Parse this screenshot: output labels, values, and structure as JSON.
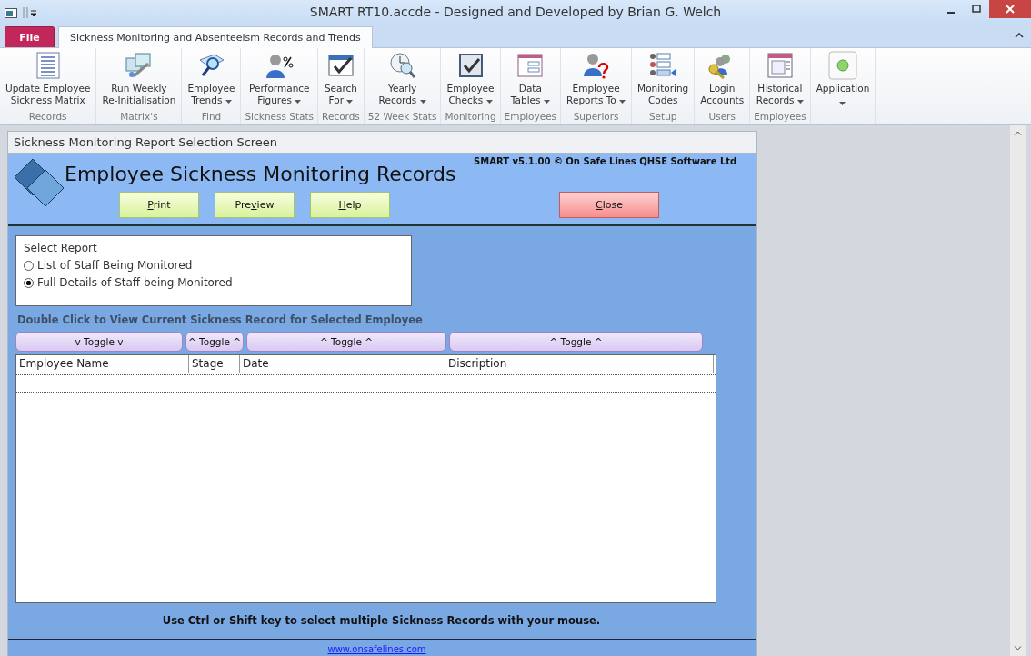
{
  "window": {
    "title": "SMART RT10.accde - Designed and Developed by Brian G. Welch"
  },
  "ribbon_tabs": [
    {
      "label": "File",
      "kind": "file",
      "selected": false
    },
    {
      "label": "Sickness Monitoring and Absenteeism Records and Trends",
      "kind": "tab",
      "selected": true
    }
  ],
  "ribbon_groups": [
    {
      "label": "Records",
      "button": {
        "lines": [
          "Update Employee",
          "Sickness Matrix"
        ],
        "dropdown": false
      }
    },
    {
      "label": "Matrix's",
      "button": {
        "lines": [
          "Run Weekly",
          "Re-Initialisation"
        ],
        "dropdown": false
      }
    },
    {
      "label": "Find",
      "button": {
        "lines": [
          "Employee",
          "Trends"
        ],
        "dropdown": true
      }
    },
    {
      "label": "Sickness Stats",
      "button": {
        "lines": [
          "Performance",
          "Figures"
        ],
        "dropdown": true
      }
    },
    {
      "label": "Records",
      "button": {
        "lines": [
          "Search",
          "For"
        ],
        "dropdown": true
      }
    },
    {
      "label": "52 Week Stats",
      "button": {
        "lines": [
          "Yearly",
          "Records"
        ],
        "dropdown": true
      }
    },
    {
      "label": "Monitoring",
      "button": {
        "lines": [
          "Employee",
          "Checks"
        ],
        "dropdown": true
      }
    },
    {
      "label": "Employees",
      "button": {
        "lines": [
          "Data",
          "Tables"
        ],
        "dropdown": true
      }
    },
    {
      "label": "Superiors",
      "button": {
        "lines": [
          "Employee",
          "Reports To"
        ],
        "dropdown": true
      }
    },
    {
      "label": "Setup",
      "button": {
        "lines": [
          "Monitoring",
          "Codes"
        ],
        "dropdown": false
      }
    },
    {
      "label": "Users",
      "button": {
        "lines": [
          "Login",
          "Accounts"
        ],
        "dropdown": false
      }
    },
    {
      "label": "Employees",
      "button": {
        "lines": [
          "Historical",
          "Records"
        ],
        "dropdown": true
      }
    },
    {
      "button": {
        "lines": [
          "Application"
        ],
        "dropdown": true
      }
    }
  ],
  "form": {
    "title": "Sickness Monitoring Report Selection Screen",
    "heading": "Employee Sickness Monitoring Records",
    "version": "SMART v5.1.00 © On Safe Lines QHSE Software Ltd",
    "buttons": [
      {
        "hotkey": "P",
        "after": "rint",
        "kind": "action"
      },
      {
        "before": "Pre",
        "hotkey": "v",
        "after": "iew",
        "kind": "action"
      },
      {
        "hotkey": "H",
        "after": "elp",
        "kind": "action"
      },
      {
        "hotkey": "C",
        "after": "lose",
        "kind": "close"
      }
    ],
    "select_report": {
      "title": "Select Report",
      "options": [
        {
          "label": "List of Staff Being Monitored",
          "selected": false
        },
        {
          "label": "Full Details of Staff being Monitored",
          "selected": true
        }
      ]
    },
    "instruction": "Double Click to View Current Sickness Record for Selected Employee",
    "toggles": [
      "v Toggle v",
      "^ Toggle ^",
      "^ Toggle ^",
      "^ Toggle ^"
    ],
    "table": {
      "columns": [
        "Employee Name",
        "Stage",
        "Date",
        "Discription"
      ]
    },
    "footer_note": "Use Ctrl or Shift key to select multiple Sickness Records with your mouse.",
    "link": "www.onsafelines.com"
  }
}
